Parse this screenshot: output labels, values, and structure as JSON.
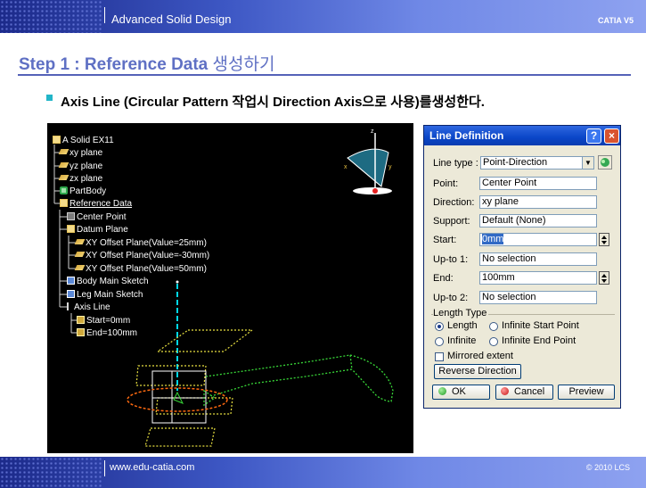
{
  "header": {
    "title": "Advanced Solid Design",
    "right_label": "CATIA V5"
  },
  "footer": {
    "url": "www.edu-catia.com",
    "copyright": "© 2010 LCS"
  },
  "slide": {
    "title_en": "Step 1 : Reference Data",
    "title_ko": "생성하기",
    "bullet": "Axis Line (Circular Pattern 작업시 Direction Axis으로 사용)를생성한다."
  },
  "tree": {
    "root": "A Solid EX11",
    "xy_plane": "xy plane",
    "yz_plane": "yz plane",
    "zx_plane": "zx plane",
    "partbody": "PartBody",
    "reference_data": "Reference Data",
    "center_point": "Center Point",
    "datum_plane": "Datum Plane",
    "offset_25": "XY Offset Plane(Value=25mm)",
    "offset_m30": "XY Offset Plane(Value=-30mm)",
    "offset_50": "XY Offset Plane(Value=50mm)",
    "body_sketch": "Body Main Sketch",
    "leg_sketch": "Leg Main Sketch",
    "axis_line": "Axis Line",
    "start": "Start=0mm",
    "end": "End=100mm"
  },
  "dialog": {
    "title": "Line Definition",
    "help_label": "?",
    "close_label": "×",
    "line_type_label": "Line type :",
    "line_type_value": "Point-Direction",
    "point_label": "Point:",
    "point_value": "Center Point",
    "direction_label": "Direction:",
    "direction_value": "xy plane",
    "support_label": "Support:",
    "support_value": "Default (None)",
    "start_label": "Start:",
    "start_value": "0mm",
    "upto1_label": "Up-to 1:",
    "upto1_value": "No selection",
    "end_label": "End:",
    "end_value": "100mm",
    "upto2_label": "Up-to 2:",
    "upto2_value": "No selection",
    "length_type_label": "Length Type",
    "length_option": "Length",
    "infinite_start_option": "Infinite Start Point",
    "infinite_option": "Infinite",
    "infinite_end_option": "Infinite End Point",
    "length_type_selected": "Length",
    "mirrored_label": "Mirrored extent",
    "mirrored_checked": false,
    "reverse_label": "Reverse Direction",
    "ok_label": "OK",
    "cancel_label": "Cancel",
    "preview_label": "Preview"
  },
  "colors": {
    "title_blue": "#5f70c4",
    "band_dark": "#1c2a8a",
    "band_light": "#8ea2f0",
    "bullet_cyan": "#22b5c8",
    "dialog_title": "#0a46c8",
    "wireframe_yellow": "#e8e040",
    "wireframe_green": "#38d838",
    "axis_cyan": "#00d8e8",
    "circle_orange": "#ff6a10"
  },
  "icons": [
    "tree-root-icon",
    "plane-icon",
    "partbody-icon",
    "geometrical-set-icon",
    "point-icon",
    "sketch-icon",
    "line-icon",
    "compass-icon",
    "help-icon",
    "close-icon",
    "dropdown-arrow-icon",
    "paint-icon",
    "spinner-icon",
    "ok-dot-icon",
    "cancel-dot-icon"
  ]
}
